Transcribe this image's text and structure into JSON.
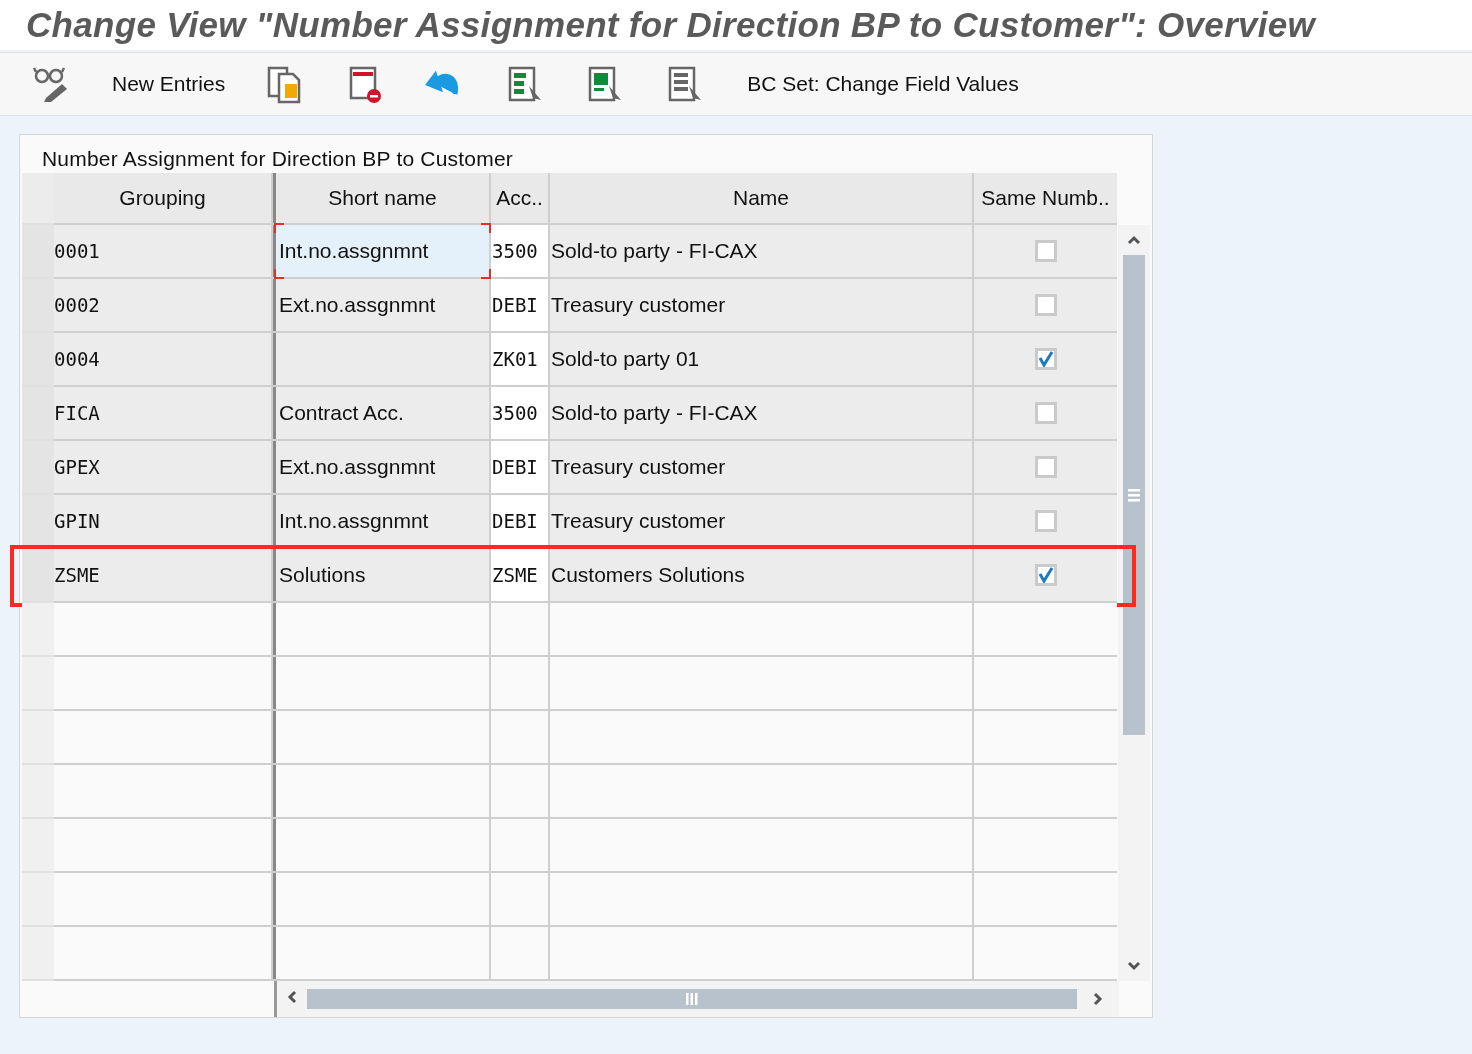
{
  "window": {
    "title": "Change View \"Number Assignment for Direction BP to Customer\": Overview"
  },
  "toolbar": {
    "buttons": [
      {
        "label": "New Entries"
      },
      {
        "label": "BC Set: Change Field Values"
      }
    ]
  },
  "table": {
    "title": "Number Assignment for Direction BP to Customer",
    "columns": [
      "Grouping",
      "Short name",
      "Acc..",
      "Name",
      "Same Numb.."
    ],
    "rows": [
      {
        "grouping": "0001",
        "short_name": "Int.no.assgnmnt",
        "acc": "3500",
        "name": "Sold-to party - FI-CAX",
        "same_number": false,
        "focused": true,
        "highlighted": false
      },
      {
        "grouping": "0002",
        "short_name": "Ext.no.assgnmnt",
        "acc": "DEBI",
        "name": "Treasury customer",
        "same_number": false,
        "focused": false,
        "highlighted": false
      },
      {
        "grouping": "0004",
        "short_name": "",
        "acc": "ZK01",
        "name": "Sold-to party 01",
        "same_number": true,
        "focused": false,
        "highlighted": false
      },
      {
        "grouping": "FICA",
        "short_name": "Contract Acc.",
        "acc": "3500",
        "name": "Sold-to party - FI-CAX",
        "same_number": false,
        "focused": false,
        "highlighted": false
      },
      {
        "grouping": "GPEX",
        "short_name": "Ext.no.assgnmnt",
        "acc": "DEBI",
        "name": "Treasury customer",
        "same_number": false,
        "focused": false,
        "highlighted": false
      },
      {
        "grouping": "GPIN",
        "short_name": "Int.no.assgnmnt",
        "acc": "DEBI",
        "name": "Treasury customer",
        "same_number": false,
        "focused": false,
        "highlighted": false
      },
      {
        "grouping": "ZSME",
        "short_name": "Solutions",
        "acc": "ZSME",
        "name": "Customers Solutions",
        "same_number": true,
        "focused": false,
        "highlighted": true
      }
    ]
  }
}
